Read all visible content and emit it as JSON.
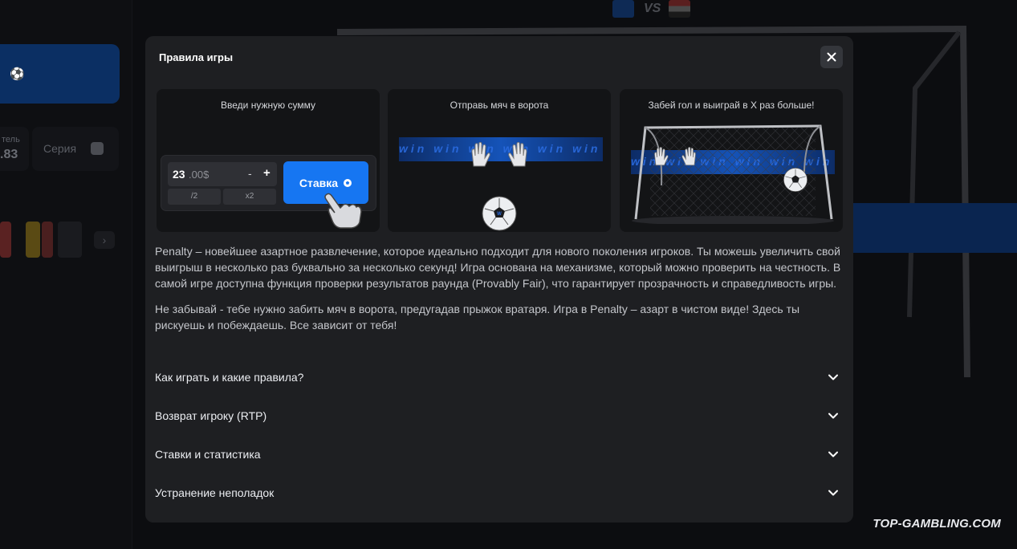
{
  "background": {
    "series_label": "Серия",
    "stat_label": "тель",
    "stat_value": ".83",
    "vs_label": "VS"
  },
  "watermark": "TOP-GAMBLING.COM",
  "modal": {
    "title": "Правила игры",
    "steps": [
      {
        "title": "Введи нужную сумму"
      },
      {
        "title": "Отправь мяч в ворота"
      },
      {
        "title": "Забей гол и выиграй в Х раз больше!"
      }
    ],
    "bet_widget": {
      "amount_int": "23",
      "amount_dec": ".00$",
      "minus": "-",
      "plus": "+",
      "half": "/2",
      "double": "x2",
      "stake_label": "Ставка"
    },
    "stripe_text": "win win win win win win",
    "paragraphs": [
      "Penalty – новейшее азартное развлечение, которое идеально подходит для нового поколения игроков. Ты можешь увеличить свой выигрыш в несколько раз буквально за несколько секунд! Игра основана на механизме, который можно проверить на честность. В самой игре доступна функция проверки результатов раунда (Provably Fair), что гарантирует прозрачность и справедливость игры.",
      "Не забывай - тебе нужно забить мяч в ворота, предугадав прыжок вратаря. Игра в Penalty – азарт в чистом виде! Здесь ты рискуешь и побеждаешь. Все зависит от тебя!"
    ],
    "faq": [
      {
        "question": "Как играть и какие правила?"
      },
      {
        "question": "Возврат игроку (RTP)"
      },
      {
        "question": "Ставки и статистика"
      },
      {
        "question": "Устранение неполадок"
      }
    ]
  },
  "colors": {
    "accent": "#1676f2",
    "modal_bg": "#1e1f22",
    "card_bg": "#131416"
  }
}
